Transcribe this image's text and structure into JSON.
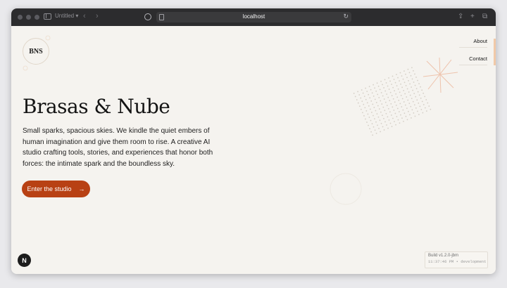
{
  "browser": {
    "tab_title": "Untitled",
    "url": "localhost",
    "colors": {
      "chrome": "#2c2c2e",
      "urlbar": "#3a3a3c"
    }
  },
  "site": {
    "logo_text": "BNS",
    "nav": {
      "about": "About",
      "contact": "Contact"
    },
    "hero": {
      "title": "Brasas & Nube",
      "description": "Small sparks, spacious skies. We kindle the quiet embers of human imagination and give them room to rise. A creative AI studio crafting tools, stories, and experiences that honor both forces: the intimate spark and the boundless sky.",
      "cta_label": "Enter the studio",
      "cta_arrow": "→"
    },
    "dev_badge": "N",
    "build": {
      "version": "Build v1.2.0-jbm",
      "time": "11:37:46 PM • development"
    },
    "colors": {
      "background": "#f5f3ef",
      "accent": "#b84114",
      "text": "#141414"
    }
  }
}
